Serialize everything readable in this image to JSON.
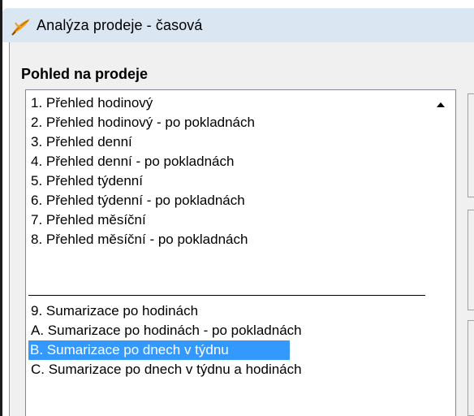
{
  "window": {
    "title": "Analýza prodeje - časová"
  },
  "section": {
    "title": "Pohled na prodeje"
  },
  "list": {
    "items": [
      "1. Přehled hodinový",
      "2. Přehled hodinový - po pokladnách",
      "3. Přehled denní",
      "4. Přehled denní - po pokladnách",
      "5. Přehled týdenní",
      "6. Přehled týdenní - po pokladnách",
      "7. Přehled měsíční",
      "8. Přehled měsíční - po pokladnách",
      "9. Sumarizace po hodinách",
      "A. Sumarizace po hodinách - po pokladnách",
      "B. Sumarizace po dnech v týdnu",
      "C. Sumarizace po dnech v týdnu a hodinách"
    ],
    "selected_item": "B. Sumarizace po dnech v týdnu"
  },
  "colors": {
    "selection": "#3399ff",
    "titlebar": "#dbe6f3",
    "panel": "#f0f0f0"
  },
  "icons": {
    "app": "feather-icon",
    "scroll": "scroll-up-arrow-icon"
  }
}
